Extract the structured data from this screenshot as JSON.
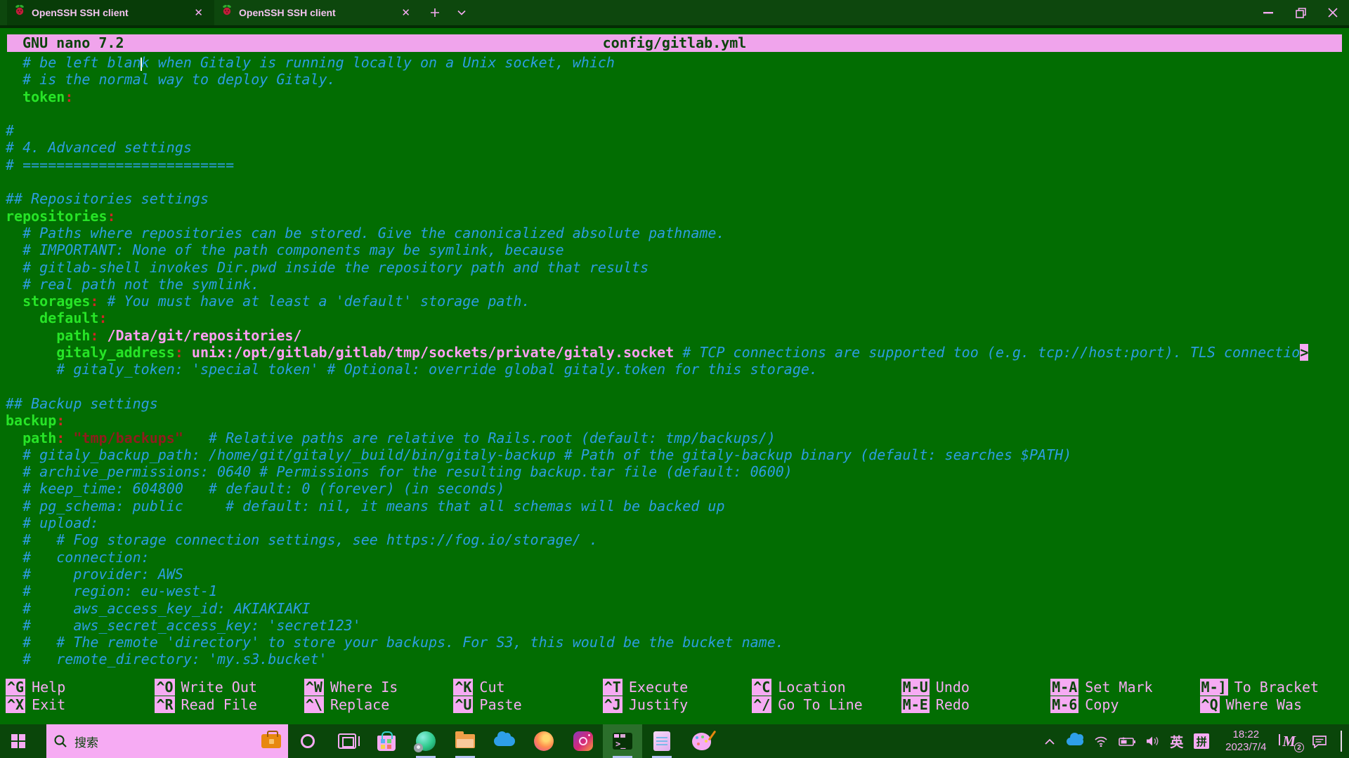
{
  "colors": {
    "bg": "#026d02",
    "chrome": "#0d470d",
    "strip": "#042b04",
    "taskbar": "#0a460a",
    "pink": "#f6abf3",
    "titlebar_pink": "#f0a4ec",
    "comment": "#2d9de2",
    "key": "#27e427",
    "red": "#d02525",
    "string_red": "#8f1d1d",
    "value_pink": "#ff9ff2",
    "dark_green_text": "#0b430b",
    "active_app_bg": "#2b6f2b",
    "indicator": "#b5c3f3",
    "briefcase_orange": "#e8880f",
    "onedrive_blue": "#2e9fe8"
  },
  "window": {
    "tabs": [
      {
        "title": "OpenSSH SSH client",
        "active": true
      },
      {
        "title": "OpenSSH SSH client",
        "active": false
      }
    ]
  },
  "nano": {
    "app_title": "GNU nano 7.2",
    "file_name": "config/gitlab.yml"
  },
  "editor": {
    "lines": [
      [
        [
          "  # be left blan",
          "comment"
        ],
        [
          "",
          "cursor"
        ],
        [
          "k when Gitaly is running locally on a Unix socket, which",
          "comment"
        ]
      ],
      [
        [
          "  # is the normal way to deploy Gitaly.",
          "comment"
        ]
      ],
      [
        [
          "  ",
          "plain"
        ],
        [
          "token",
          "key"
        ],
        [
          ":",
          "colon"
        ]
      ],
      [],
      [
        [
          "#",
          "comment"
        ]
      ],
      [
        [
          "# 4. Advanced settings",
          "comment"
        ]
      ],
      [
        [
          "# =========================",
          "comment"
        ]
      ],
      [],
      [
        [
          "## Repositories settings",
          "comment"
        ]
      ],
      [
        [
          "repositories",
          "key"
        ],
        [
          ":",
          "colon"
        ]
      ],
      [
        [
          "  # Paths where repositories can be stored. Give the canonicalized absolute pathname.",
          "comment"
        ]
      ],
      [
        [
          "  # IMPORTANT: None of the path components may be symlink, because",
          "comment"
        ]
      ],
      [
        [
          "  # gitlab-shell invokes Dir.pwd inside the repository path and that results",
          "comment"
        ]
      ],
      [
        [
          "  # real path not the symlink.",
          "comment"
        ]
      ],
      [
        [
          "  ",
          "plain"
        ],
        [
          "storages",
          "key"
        ],
        [
          ":",
          "colon"
        ],
        [
          " ",
          "plain"
        ],
        [
          "# You must have at least a 'default' storage path.",
          "comment"
        ]
      ],
      [
        [
          "    ",
          "plain"
        ],
        [
          "default",
          "key"
        ],
        [
          ":",
          "colon"
        ]
      ],
      [
        [
          "      ",
          "plain"
        ],
        [
          "path",
          "key"
        ],
        [
          ":",
          "colon"
        ],
        [
          " /Data/git/repositories/",
          "value"
        ]
      ],
      [
        [
          "      ",
          "plain"
        ],
        [
          "gitaly_address",
          "key"
        ],
        [
          ":",
          "colon"
        ],
        [
          " unix:/opt/gitlab/gitlab/tmp/sockets/private/gitaly.socket",
          "value"
        ],
        [
          " ",
          "plain"
        ],
        [
          "# TCP connections are supported too (e.g. tcp://host:port). TLS connectio",
          "comment"
        ],
        [
          ">",
          "cont"
        ]
      ],
      [
        [
          "      # gitaly_token: 'special token' # Optional: override global gitaly.token for this storage.",
          "comment"
        ]
      ],
      [],
      [
        [
          "## Backup settings",
          "comment"
        ]
      ],
      [
        [
          "backup",
          "key"
        ],
        [
          ":",
          "colon"
        ]
      ],
      [
        [
          "  ",
          "plain"
        ],
        [
          "path",
          "key"
        ],
        [
          ":",
          "colon"
        ],
        [
          " ",
          "plain"
        ],
        [
          "\"tmp/backups\"",
          "string"
        ],
        [
          "   ",
          "plain"
        ],
        [
          "# Relative paths are relative to Rails.root (default: tmp/backups/)",
          "comment"
        ]
      ],
      [
        [
          "  # gitaly_backup_path: /home/git/gitaly/_build/bin/gitaly-backup # Path of the gitaly-backup binary (default: searches $PATH)",
          "comment"
        ]
      ],
      [
        [
          "  # archive_permissions: 0640 # Permissions for the resulting backup.tar file (default: 0600)",
          "comment"
        ]
      ],
      [
        [
          "  # keep_time: 604800   # default: 0 (forever) (in seconds)",
          "comment"
        ]
      ],
      [
        [
          "  # pg_schema: public     # default: nil, it means that all schemas will be backed up",
          "comment"
        ]
      ],
      [
        [
          "  # upload:",
          "comment"
        ]
      ],
      [
        [
          "  #   # Fog storage connection settings, see https://fog.io/storage/ .",
          "comment"
        ]
      ],
      [
        [
          "  #   connection:",
          "comment"
        ]
      ],
      [
        [
          "  #     provider: AWS",
          "comment"
        ]
      ],
      [
        [
          "  #     region: eu-west-1",
          "comment"
        ]
      ],
      [
        [
          "  #     aws_access_key_id: AKIAKIAKI",
          "comment"
        ]
      ],
      [
        [
          "  #     aws_secret_access_key: 'secret123'",
          "comment"
        ]
      ],
      [
        [
          "  #   # The remote 'directory' to store your backups. For S3, this would be the bucket name.",
          "comment"
        ]
      ],
      [
        [
          "  #   remote_directory: 'my.s3.bucket'",
          "comment"
        ]
      ]
    ]
  },
  "shortcuts": {
    "rows": [
      [
        {
          "key": "^G",
          "label": "Help"
        },
        {
          "key": "^O",
          "label": "Write Out"
        },
        {
          "key": "^W",
          "label": "Where Is"
        },
        {
          "key": "^K",
          "label": "Cut"
        },
        {
          "key": "^T",
          "label": "Execute"
        },
        {
          "key": "^C",
          "label": "Location"
        },
        {
          "key": "M-U",
          "label": "Undo"
        },
        {
          "key": "M-A",
          "label": "Set Mark"
        },
        {
          "key": "M-]",
          "label": "To Bracket"
        }
      ],
      [
        {
          "key": "^X",
          "label": "Exit"
        },
        {
          "key": "^R",
          "label": "Read File"
        },
        {
          "key": "^\\",
          "label": "Replace"
        },
        {
          "key": "^U",
          "label": "Paste"
        },
        {
          "key": "^J",
          "label": "Justify"
        },
        {
          "key": "^/",
          "label": "Go To Line"
        },
        {
          "key": "M-E",
          "label": "Redo"
        },
        {
          "key": "M-6",
          "label": "Copy"
        },
        {
          "key": "^Q",
          "label": "Where Was"
        }
      ]
    ]
  },
  "taskbar": {
    "search_placeholder": "搜索",
    "apps": [
      {
        "name": "task-view",
        "running": false,
        "active": false
      },
      {
        "name": "store",
        "running": false,
        "active": false
      },
      {
        "name": "edge",
        "running": true,
        "active": false
      },
      {
        "name": "file-explorer",
        "running": true,
        "active": false
      },
      {
        "name": "onedrive",
        "running": false,
        "active": false
      },
      {
        "name": "firefox",
        "running": false,
        "active": false
      },
      {
        "name": "instagram",
        "running": false,
        "active": false
      },
      {
        "name": "terminal",
        "running": true,
        "active": true
      },
      {
        "name": "notepad",
        "running": true,
        "active": false
      },
      {
        "name": "paint",
        "running": false,
        "active": false
      }
    ],
    "tray": {
      "ime_lang": "英",
      "ime_mode": "拼",
      "time": "18:22",
      "date": "2023/7/4",
      "ime_letter": "M",
      "ime_badge": "2"
    }
  }
}
